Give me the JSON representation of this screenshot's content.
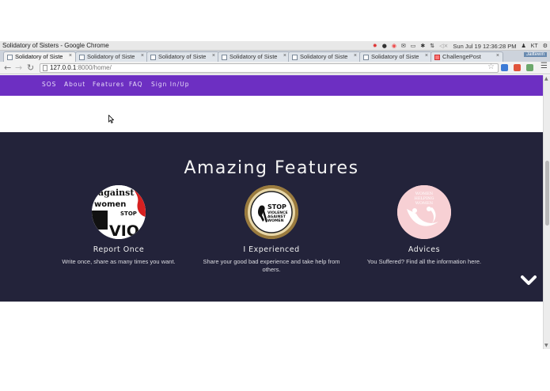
{
  "window": {
    "title": "Solidatory of Sisters - Google Chrome",
    "clock": "Sun Jul 19 12:36:28 PM",
    "user": "KT"
  },
  "tabs": [
    {
      "label": "Solidatory of Siste",
      "active": true
    },
    {
      "label": "Solidatory of Siste",
      "active": false
    },
    {
      "label": "Solidatory of Siste",
      "active": false
    },
    {
      "label": "Solidatory of Siste",
      "active": false
    },
    {
      "label": "Solidatory of Siste",
      "active": false
    },
    {
      "label": "Solidatory of Siste",
      "active": false
    },
    {
      "label": "ChallengePost",
      "active": false
    }
  ],
  "tab_close": "×",
  "newtab_label": "Jailtewin",
  "address": {
    "host": "127.0.0.1",
    "path": ":8000/home/"
  },
  "site_nav": {
    "items": [
      "SOS",
      "About",
      "Features",
      "FAQ",
      "Sign In/Up"
    ],
    "bg_color": "#6d2fc2"
  },
  "features": {
    "heading": "Amazing Features",
    "bg_color": "#23233a",
    "items": [
      {
        "title": "Report Once",
        "description": "Write once, share as many times you want.",
        "image": "against-women-violence-poster",
        "image_text": [
          "against",
          "women",
          "STOP",
          "VIO"
        ]
      },
      {
        "title": "I Experienced",
        "description": "Share your good bad experience and take help from others.",
        "image": "stop-violence-ribbon-badge",
        "image_text": [
          "STOP",
          "VIOLENCE",
          "AGAINST",
          "WOMEN"
        ]
      },
      {
        "title": "Advices",
        "description": "You Suffered? Find all the information here.",
        "image": "women-helping-women-logo",
        "image_text": [
          "WOMEN",
          "HELPING",
          "WOMEN"
        ]
      }
    ]
  }
}
